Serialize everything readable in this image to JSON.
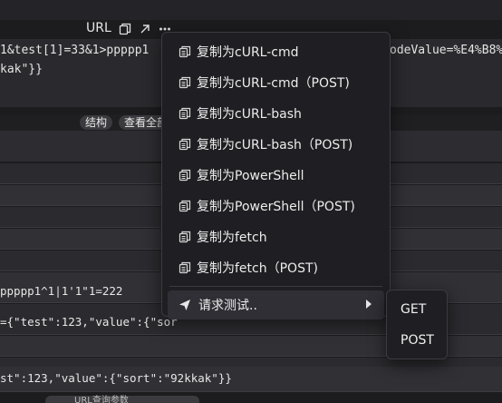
{
  "toolbar": {
    "url_label": "URL",
    "icons": [
      "copy-icon",
      "external-link-icon",
      "more-icon"
    ]
  },
  "url_text": {
    "line1_left": "1&test[1]=33&1>ppppp1",
    "line1_right": "odeValue=%E4%B8%",
    "line2_left": "kak\"}}"
  },
  "view_tabs": {
    "structure": "结构",
    "view_all": "查看全部"
  },
  "rows": [
    {
      "text": ""
    },
    {
      "text": ""
    },
    {
      "text": ""
    },
    {
      "text": ""
    },
    {
      "text": ""
    },
    {
      "text": "ppppp1^1|1'1\"1=222"
    },
    {
      "text": "={\"test\":123,\"value\":{\"sor"
    },
    {
      "text": ""
    },
    {
      "text": ""
    },
    {
      "text": "st\":123,\"value\":{\"sort\":\"92kkak\"}}"
    }
  ],
  "context_menu": {
    "items": [
      {
        "label": "复制为cURL-cmd",
        "icon": "copy-icon"
      },
      {
        "label": "复制为cURL-cmd（POST)",
        "icon": "copy-icon"
      },
      {
        "label": "复制为cURL-bash",
        "icon": "copy-icon"
      },
      {
        "label": "复制为cURL-bash（POST)",
        "icon": "copy-icon"
      },
      {
        "label": "复制为PowerShell",
        "icon": "copy-icon"
      },
      {
        "label": "复制为PowerShell（POST)",
        "icon": "copy-icon"
      },
      {
        "label": "复制为fetch",
        "icon": "copy-icon"
      },
      {
        "label": "复制为fetch（POST)",
        "icon": "copy-icon"
      }
    ],
    "request_test": {
      "label": "请求测试..",
      "icon": "send-icon"
    }
  },
  "submenu": {
    "items": [
      "GET",
      "POST"
    ]
  },
  "bottom_fragment": "URL查询参数"
}
